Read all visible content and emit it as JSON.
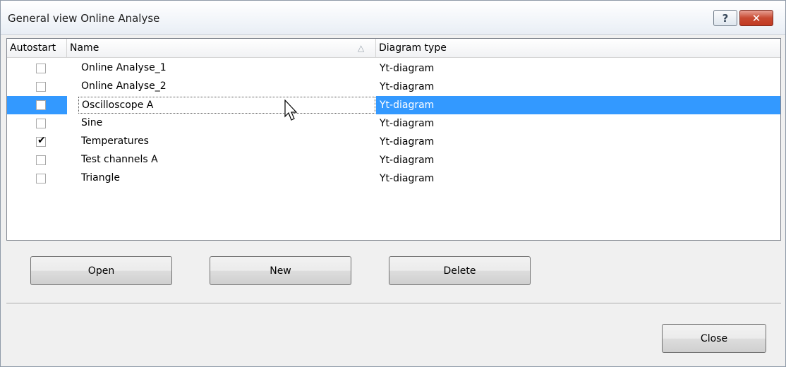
{
  "window": {
    "title": "General view Online Analyse",
    "help_glyph": "?",
    "close_glyph": "✕"
  },
  "table": {
    "columns": [
      "Autostart",
      "Name",
      "Diagram type"
    ],
    "sort_indicator": "△",
    "rows": [
      {
        "autostart": false,
        "name": "Online Analyse_1",
        "type": "Yt-diagram",
        "selected": false
      },
      {
        "autostart": false,
        "name": "Online Analyse_2",
        "type": "Yt-diagram",
        "selected": false
      },
      {
        "autostart": false,
        "name": "Oscilloscope A",
        "type": "Yt-diagram",
        "selected": true
      },
      {
        "autostart": false,
        "name": "Sine",
        "type": "Yt-diagram",
        "selected": false
      },
      {
        "autostart": true,
        "name": "Temperatures",
        "type": "Yt-diagram",
        "selected": false
      },
      {
        "autostart": false,
        "name": "Test channels A",
        "type": "Yt-diagram",
        "selected": false
      },
      {
        "autostart": false,
        "name": "Triangle",
        "type": "Yt-diagram",
        "selected": false
      }
    ]
  },
  "buttons": {
    "open": "Open",
    "new": "New",
    "delete": "Delete",
    "close": "Close"
  },
  "colors": {
    "selection": "#3399ff",
    "close_button": "#c84a32"
  },
  "icons": {
    "checkmark": "✔"
  }
}
